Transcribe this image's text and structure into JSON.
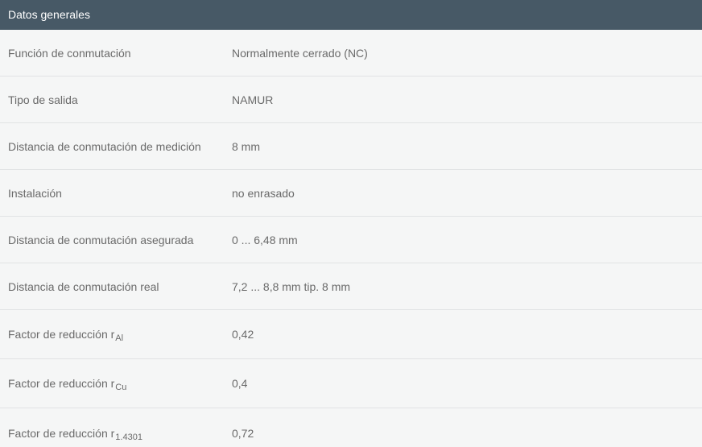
{
  "header": {
    "title": "Datos generales"
  },
  "rows": [
    {
      "label": "Función de conmutación",
      "value": "Normalmente cerrado (NC)"
    },
    {
      "label": "Tipo de salida",
      "value": "NAMUR"
    },
    {
      "label": "Distancia de conmutación de medición",
      "value": "8 mm"
    },
    {
      "label": "Instalación",
      "value": "no enrasado"
    },
    {
      "label": "Distancia de conmutación asegurada",
      "value": "0 ... 6,48 mm"
    },
    {
      "label": "Distancia de conmutación real",
      "value": "7,2 ... 8,8 mm tip. 8 mm"
    },
    {
      "label": "Factor de reducción r",
      "label_sub": "Al",
      "value": "0,42"
    },
    {
      "label": "Factor de reducción r",
      "label_sub": "Cu",
      "value": "0,4"
    },
    {
      "label": "Factor de reducción r",
      "label_sub": "1.4301",
      "value": "0,72"
    }
  ]
}
